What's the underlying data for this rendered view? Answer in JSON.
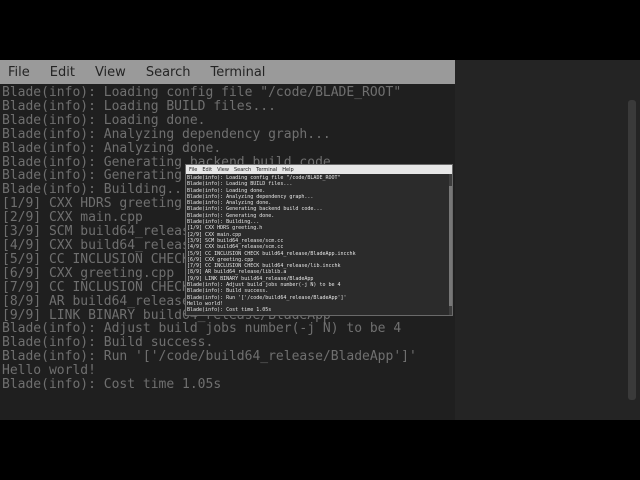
{
  "menu": [
    "File",
    "Edit",
    "View",
    "Search",
    "Terminal",
    "Help"
  ],
  "terminal_lines": [
    "Blade(info): Loading config file \"/code/BLADE_ROOT\"",
    "Blade(info): Loading BUILD files...",
    "Blade(info): Loading done.",
    "Blade(info): Analyzing dependency graph...",
    "Blade(info): Analyzing done.",
    "Blade(info): Generating backend build code...",
    "Blade(info): Generating done.",
    "Blade(info): Building...",
    "[1/9] CXX HDRS greeting.h",
    "[2/9] CXX main.cpp",
    "[3/9] SCM build64_release/scm.cc",
    "[4/9] CXX build64_release/scm.cc",
    "[5/9] CC INCLUSION CHECK build64_release/BladeApp.incchk",
    "[6/9] CXX greeting.cpp",
    "[7/9] CC INCLUSION CHECK build64_release/lib.incchk",
    "[8/9] AR build64_release/liblib.a",
    "[9/9] LINK BINARY build64_release/BladeApp",
    "Blade(info): Adjust build jobs number(-j N) to be 4",
    "Blade(info): Build success.",
    "Blade(info): Run '['/code/build64_release/BladeApp']'",
    "Hello world!",
    "Blade(info): Cost time 1.05s"
  ]
}
